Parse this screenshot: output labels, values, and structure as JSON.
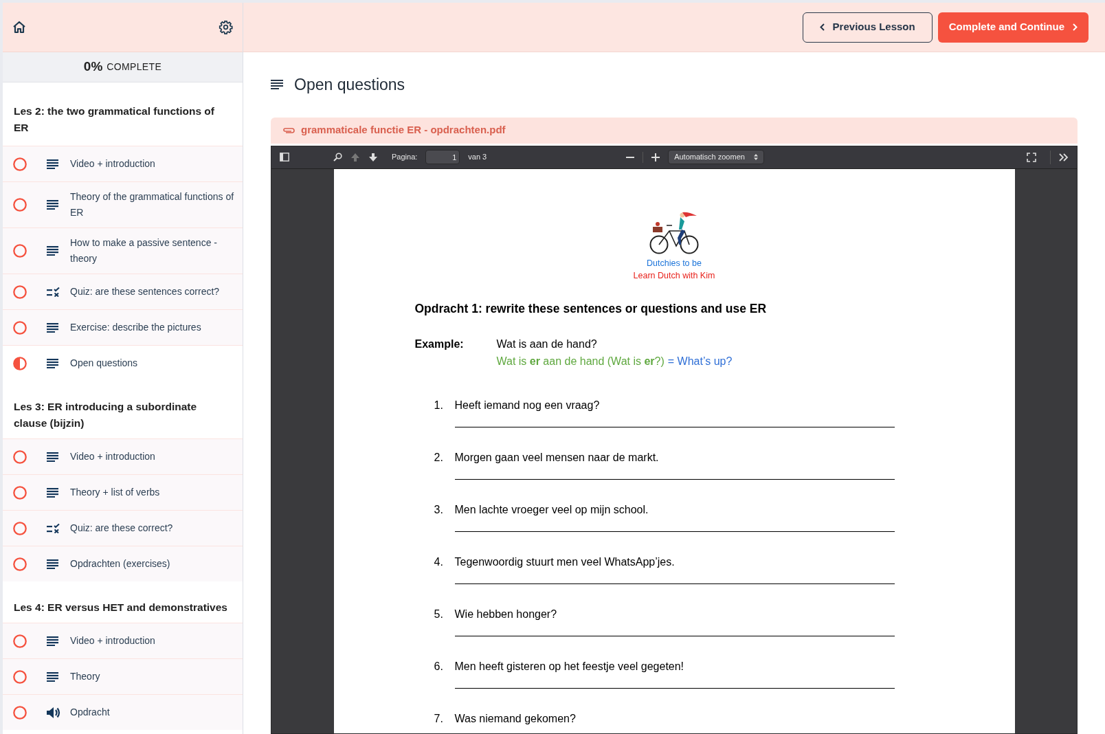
{
  "sidebar": {
    "progress": {
      "percent": "0%",
      "label": "COMPLETE"
    },
    "sections": [
      {
        "title": "Les 2: the two grammatical functions of ER",
        "items": [
          {
            "label": "Video + introduction",
            "kind": "text",
            "started": false
          },
          {
            "label": "Theory of the grammatical functions of ER",
            "kind": "text",
            "started": false
          },
          {
            "label": "How to make a passive sentence - theory",
            "kind": "text",
            "started": false
          },
          {
            "label": "Quiz: are these sentences correct?",
            "kind": "quiz",
            "started": false
          },
          {
            "label": "Exercise: describe the pictures",
            "kind": "text",
            "started": false
          },
          {
            "label": "Open questions",
            "kind": "text",
            "started": true
          }
        ]
      },
      {
        "title": "Les 3: ER introducing a subordinate clause (bijzin)",
        "items": [
          {
            "label": "Video + introduction",
            "kind": "text",
            "started": false
          },
          {
            "label": "Theory + list of verbs",
            "kind": "text",
            "started": false
          },
          {
            "label": "Quiz: are these correct?",
            "kind": "quiz",
            "started": false
          },
          {
            "label": "Opdrachten (exercises)",
            "kind": "text",
            "started": false
          }
        ]
      },
      {
        "title": "Les 4: ER versus HET and demonstratives",
        "items": [
          {
            "label": "Video + introduction",
            "kind": "text",
            "started": false
          },
          {
            "label": "Theory",
            "kind": "text",
            "started": false
          },
          {
            "label": "Opdracht",
            "kind": "audio",
            "started": false
          }
        ]
      }
    ]
  },
  "header": {
    "previous_button": "Previous Lesson",
    "next_button": "Complete and Continue"
  },
  "lesson": {
    "title": "Open questions",
    "attachment": "grammaticale functie ER - opdrachten.pdf"
  },
  "pdf_viewer": {
    "page_label": "Pagina:",
    "page": "1",
    "page_total": "van 3",
    "zoom": "Automatisch zoomen",
    "document": {
      "brand": "Dutchies to be",
      "tagline": "Learn Dutch with Kim",
      "heading": "Opdracht 1: rewrite these sentences or questions and use ER",
      "example_label": "Example:",
      "example_question": "Wat is aan de hand?",
      "example_answer": "Wat is **er** aan de hand (Wat is **er**?)",
      "example_translation": "= What’s up?",
      "questions": [
        {
          "number": "1.",
          "text": "Heeft iemand nog een vraag?"
        },
        {
          "number": "2.",
          "text": "Morgen gaan veel mensen naar de markt."
        },
        {
          "number": "3.",
          "text": "Men lachte vroeger veel op mijn school."
        },
        {
          "number": "4.",
          "text": "Tegenwoordig stuurt men veel WhatsApp’jes."
        },
        {
          "number": "5.",
          "text": "Wie hebben honger?"
        },
        {
          "number": "6.",
          "text": "Men heeft gisteren op het feestje veel gegeten!"
        },
        {
          "number": "7.",
          "text": "Was niemand gekomen?"
        }
      ]
    }
  }
}
